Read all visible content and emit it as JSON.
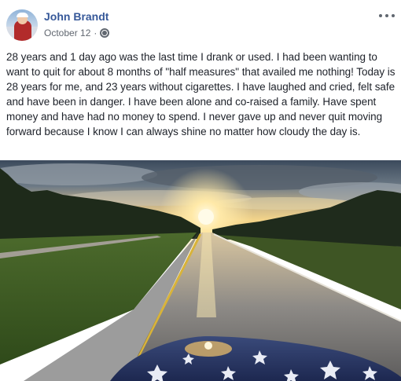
{
  "post": {
    "author": "John Brandt",
    "date": "October 12",
    "separator": "·",
    "privacy_icon": "globe-icon",
    "more_icon": "more-options-icon",
    "text": "28 years and 1 day ago was the last time I drank or used. I had been wanting to want to quit for about 8 months of \"half measures\" that availed me nothing! Today is 28 years for me, and 23 years without cigarettes. I have laughed and cried, felt safe and have been in danger. I have been alone and co-raised a family. Have spent money and have had no money to spend. I never gave up and never quit moving forward because I know I can always shine no matter how cloudy the day is."
  },
  "colors": {
    "author_link": "#365899",
    "meta_text": "#616770",
    "body_text": "#1d2129"
  }
}
